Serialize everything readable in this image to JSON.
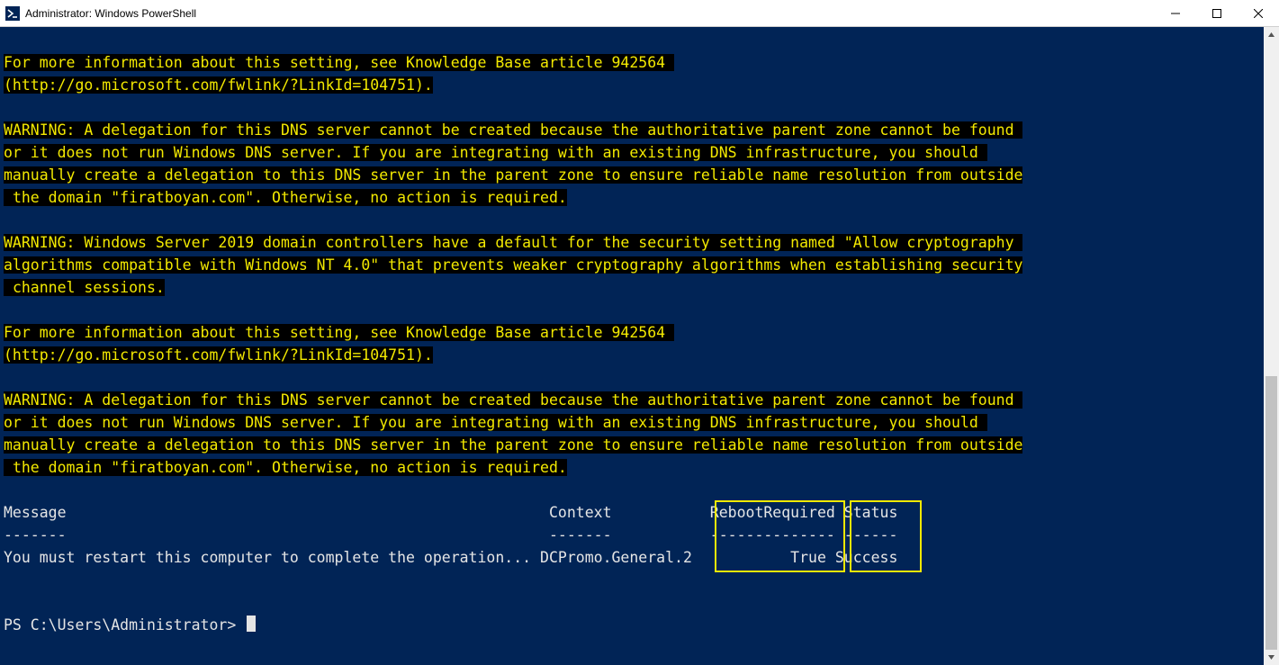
{
  "window": {
    "title": "Administrator: Windows PowerShell"
  },
  "lines": {
    "info1a": "For more information about this setting, see Knowledge Base article 942564 ",
    "info1b": "(http://go.microsoft.com/fwlink/?LinkId=104751).",
    "warn_dns_1": "WARNING: A delegation for this DNS server cannot be created because the authoritative parent zone cannot be found ",
    "warn_dns_2": "or it does not run Windows DNS server. If you are integrating with an existing DNS infrastructure, you should ",
    "warn_dns_3": "manually create a delegation to this DNS server in the parent zone to ensure reliable name resolution from outside",
    "warn_dns_4": " the domain \"firatboyan.com\". Otherwise, no action is required.",
    "warn_crypto_1": "WARNING: Windows Server 2019 domain controllers have a default for the security setting named \"Allow cryptography ",
    "warn_crypto_2": "algorithms compatible with Windows NT 4.0\" that prevents weaker cryptography algorithms when establishing security",
    "warn_crypto_3": " channel sessions.",
    "table_header": "Message                                                      Context           RebootRequired Status ",
    "table_divider": "-------                                                      -------           -------------- ------ ",
    "table_row": "You must restart this computer to complete the operation... DCPromo.General.2           True Success",
    "prompt": "PS C:\\Users\\Administrator> "
  },
  "table": {
    "columns": [
      "Message",
      "Context",
      "RebootRequired",
      "Status"
    ],
    "rows": [
      {
        "Message": "You must restart this computer to complete the operation...",
        "Context": "DCPromo.General.2",
        "RebootRequired": "True",
        "Status": "Success"
      }
    ]
  },
  "highlight_boxes": {
    "reboot_required": {
      "header": "RebootRequired",
      "value": "True"
    },
    "status": {
      "header": "Status",
      "value": "Success"
    }
  },
  "scrollbar": {
    "thumb_top_pct": 55,
    "thumb_height_pct": 45
  }
}
